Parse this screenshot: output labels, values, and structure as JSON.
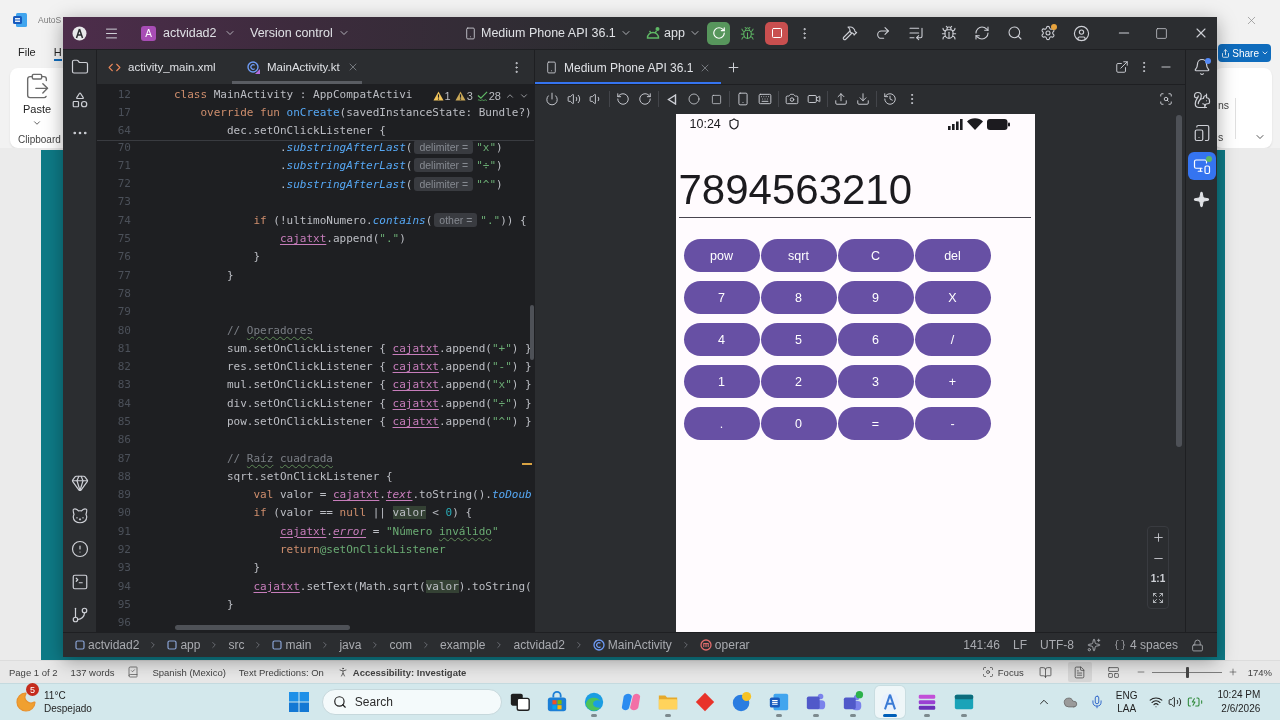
{
  "background_window": {
    "title": "AutoS",
    "menu": [
      {
        "label": "File",
        "selected": false
      },
      {
        "label": "H",
        "selected": true
      }
    ],
    "share": "Share",
    "paste": "Paste",
    "clipboard_group": "Clipboard",
    "ribbon_fragments": [
      "ns",
      "s"
    ]
  },
  "ide": {
    "title_bar": {
      "project_badge": "A",
      "project": "actvidad2",
      "version_control": "Version control",
      "device": "Medium Phone API 36.1",
      "run_config": "app"
    },
    "editor": {
      "tabs": [
        {
          "label": "activity_main.xml",
          "kind": "xml",
          "selected": false
        },
        {
          "label": "MainActivity.kt",
          "kind": "kotlin",
          "selected": true
        }
      ],
      "inspections": {
        "warnings": "1",
        "weak_warnings": "3",
        "typos": "28"
      },
      "sticky_lines": [
        {
          "number": "12",
          "code": [
            {
              "text": "class ",
              "kind": "kw"
            },
            {
              "text": "MainActivity : AppCompatActivi",
              "kind": "plain"
            }
          ]
        },
        {
          "number": "17",
          "code": [
            {
              "text": "    override fun ",
              "kind": "kw"
            },
            {
              "text": "onCreate",
              "kind": "fn"
            },
            {
              "text": "(savedInstanceState: Bundle?)",
              "kind": "plain"
            }
          ]
        },
        {
          "number": "64",
          "code": [
            {
              "text": "        dec.setOnClickListener {",
              "kind": "plain"
            }
          ]
        }
      ],
      "lines": [
        {
          "number": "70",
          "code": [
            {
              "text": "                .",
              "kind": "plain"
            },
            {
              "text": "substringAfterLast",
              "kind": "ext"
            },
            {
              "text": "(",
              "kind": "plain"
            },
            {
              "text": "delimiter =",
              "kind": "hint"
            },
            {
              "text": "\"x\"",
              "kind": "str"
            },
            {
              "text": ")",
              "kind": "plain"
            }
          ]
        },
        {
          "number": "71",
          "code": [
            {
              "text": "                .",
              "kind": "plain"
            },
            {
              "text": "substringAfterLast",
              "kind": "ext"
            },
            {
              "text": "(",
              "kind": "plain"
            },
            {
              "text": "delimiter =",
              "kind": "hint"
            },
            {
              "text": "\"÷\"",
              "kind": "str"
            },
            {
              "text": ")",
              "kind": "plain"
            }
          ]
        },
        {
          "number": "72",
          "code": [
            {
              "text": "                .",
              "kind": "plain"
            },
            {
              "text": "substringAfterLast",
              "kind": "ext"
            },
            {
              "text": "(",
              "kind": "plain"
            },
            {
              "text": "delimiter =",
              "kind": "hint"
            },
            {
              "text": "\"^\"",
              "kind": "str"
            },
            {
              "text": ")",
              "kind": "plain"
            }
          ]
        },
        {
          "number": "73"
        },
        {
          "number": "74",
          "code": [
            {
              "text": "            if ",
              "kind": "kw"
            },
            {
              "text": "(!ultimoNumero.",
              "kind": "plain"
            },
            {
              "text": "contains",
              "kind": "ext"
            },
            {
              "text": "(",
              "kind": "plain"
            },
            {
              "text": "other =",
              "kind": "hint"
            },
            {
              "text": "\".\"",
              "kind": "str"
            },
            {
              "text": ")) {",
              "kind": "plain"
            }
          ]
        },
        {
          "number": "75",
          "code": [
            {
              "text": "                cajatxt",
              "kind": "var"
            },
            {
              "text": ".append(",
              "kind": "plain"
            },
            {
              "text": "\".\"",
              "kind": "str"
            },
            {
              "text": ")",
              "kind": "plain"
            }
          ]
        },
        {
          "number": "76",
          "code": [
            {
              "text": "            }",
              "kind": "plain"
            }
          ]
        },
        {
          "number": "77",
          "code": [
            {
              "text": "        }",
              "kind": "plain"
            }
          ]
        },
        {
          "number": "78"
        },
        {
          "number": "79"
        },
        {
          "number": "80",
          "code": [
            {
              "text": "        // ",
              "kind": "cmt"
            },
            {
              "text": "Operadores",
              "kind": "cmt_typo"
            }
          ]
        },
        {
          "number": "81",
          "code": [
            {
              "text": "        sum.setOnClickListener { ",
              "kind": "plain"
            },
            {
              "text": "cajatxt",
              "kind": "var"
            },
            {
              "text": ".append(",
              "kind": "plain"
            },
            {
              "text": "\"+\"",
              "kind": "str"
            },
            {
              "text": ") }",
              "kind": "plain"
            }
          ]
        },
        {
          "number": "82",
          "code": [
            {
              "text": "        res.setOnClickListener { ",
              "kind": "plain"
            },
            {
              "text": "cajatxt",
              "kind": "var"
            },
            {
              "text": ".append(",
              "kind": "plain"
            },
            {
              "text": "\"-\"",
              "kind": "str"
            },
            {
              "text": ") }",
              "kind": "plain"
            }
          ]
        },
        {
          "number": "83",
          "code": [
            {
              "text": "        mul.setOnClickListener { ",
              "kind": "plain"
            },
            {
              "text": "cajatxt",
              "kind": "var"
            },
            {
              "text": ".append(",
              "kind": "plain"
            },
            {
              "text": "\"x\"",
              "kind": "str"
            },
            {
              "text": ") }",
              "kind": "plain"
            }
          ]
        },
        {
          "number": "84",
          "code": [
            {
              "text": "        div.setOnClickListener { ",
              "kind": "plain"
            },
            {
              "text": "cajatxt",
              "kind": "var"
            },
            {
              "text": ".append(",
              "kind": "plain"
            },
            {
              "text": "\"÷\"",
              "kind": "str"
            },
            {
              "text": ") }",
              "kind": "plain"
            }
          ]
        },
        {
          "number": "85",
          "code": [
            {
              "text": "        pow.setOnClickListener { ",
              "kind": "plain"
            },
            {
              "text": "cajatxt",
              "kind": "var"
            },
            {
              "text": ".append(",
              "kind": "plain"
            },
            {
              "text": "\"^\"",
              "kind": "str"
            },
            {
              "text": ") }",
              "kind": "plain"
            }
          ]
        },
        {
          "number": "86"
        },
        {
          "number": "87",
          "code": [
            {
              "text": "        // ",
              "kind": "cmt"
            },
            {
              "text": "Raíz",
              "kind": "cmt_typo"
            },
            {
              "text": " cuadrada",
              "kind": "cmt_typo"
            }
          ]
        },
        {
          "number": "88",
          "code": [
            {
              "text": "        sqrt.setOnClickListener {",
              "kind": "plain"
            }
          ]
        },
        {
          "number": "89",
          "code": [
            {
              "text": "            val ",
              "kind": "kw"
            },
            {
              "text": "valor = ",
              "kind": "plain"
            },
            {
              "text": "cajatxt",
              "kind": "var"
            },
            {
              "text": ".",
              "kind": "plain"
            },
            {
              "text": "text",
              "kind": "prop"
            },
            {
              "text": ".toString().",
              "kind": "plain"
            },
            {
              "text": "toDoub",
              "kind": "ext"
            }
          ]
        },
        {
          "number": "90",
          "code": [
            {
              "text": "            if ",
              "kind": "kw"
            },
            {
              "text": "(valor == ",
              "kind": "plain"
            },
            {
              "text": "null",
              "kind": "kw"
            },
            {
              "text": " || ",
              "kind": "plain"
            },
            {
              "text": "valor",
              "kind": "hl"
            },
            {
              "text": " < ",
              "kind": "plain"
            },
            {
              "text": "0",
              "kind": "num"
            },
            {
              "text": ") {",
              "kind": "plain"
            }
          ]
        },
        {
          "number": "91",
          "code": [
            {
              "text": "                cajatxt",
              "kind": "var"
            },
            {
              "text": ".",
              "kind": "plain"
            },
            {
              "text": "error",
              "kind": "prop"
            },
            {
              "text": " = ",
              "kind": "plain"
            },
            {
              "text": "\"Número ",
              "kind": "str"
            },
            {
              "text": "inválido",
              "kind": "str_typo"
            },
            {
              "text": "\"",
              "kind": "str"
            }
          ]
        },
        {
          "number": "92",
          "code": [
            {
              "text": "                return",
              "kind": "kw"
            },
            {
              "text": "@setOnClickListener",
              "kind": "label"
            }
          ]
        },
        {
          "number": "93",
          "code": [
            {
              "text": "            }",
              "kind": "plain"
            }
          ]
        },
        {
          "number": "94",
          "code": [
            {
              "text": "            cajatxt",
              "kind": "var"
            },
            {
              "text": ".setText(Math.sqrt(",
              "kind": "plain"
            },
            {
              "text": "valor",
              "kind": "hl"
            },
            {
              "text": ").toString(",
              "kind": "plain"
            }
          ]
        },
        {
          "number": "95",
          "code": [
            {
              "text": "        }",
              "kind": "plain"
            }
          ]
        },
        {
          "number": "96"
        }
      ]
    },
    "emulator": {
      "tabs": [
        {
          "label": "Medium Phone API 36.1",
          "selected": true
        }
      ],
      "phone": {
        "time": "10:24",
        "display": "7894563210",
        "keys": [
          [
            "pow",
            "sqrt",
            "C",
            "del"
          ],
          [
            "7",
            "8",
            "9",
            "X"
          ],
          [
            "4",
            "5",
            "6",
            "/"
          ],
          [
            "1",
            "2",
            "3",
            "+"
          ],
          [
            ".",
            "0",
            "=",
            "-"
          ]
        ]
      },
      "zoom_reset": "1:1"
    },
    "right_toolbar": [
      {
        "selected": false
      },
      {
        "selected": false
      },
      {
        "selected": false
      },
      {
        "selected": true
      },
      {
        "selected": false
      }
    ],
    "status_bar": {
      "breadcrumbs": [
        {
          "label": "actvidad2",
          "kind": "module"
        },
        {
          "label": "app",
          "kind": "module"
        },
        {
          "label": "src",
          "kind": "dir"
        },
        {
          "label": "main",
          "kind": "module"
        },
        {
          "label": "java",
          "kind": "dir"
        },
        {
          "label": "com",
          "kind": "dir"
        },
        {
          "label": "example",
          "kind": "dir"
        },
        {
          "label": "actvidad2",
          "kind": "dir"
        },
        {
          "label": "MainActivity",
          "kind": "class"
        },
        {
          "label": "operar",
          "kind": "method"
        }
      ],
      "position": "141:46",
      "line_separator": "LF",
      "encoding": "UTF-8",
      "indent": "4 spaces"
    }
  },
  "word_status_bar": {
    "page": "Page 1 of 2",
    "words": "137 words",
    "language": "Spanish (Mexico)",
    "predictions": "Text Predictions: On",
    "accessibility": "Accessibility: Investigate",
    "focus": "Focus",
    "views": [
      {
        "selected": false
      },
      {
        "selected": true
      },
      {
        "selected": false
      }
    ],
    "zoom_slider": {
      "level": 0.5
    },
    "zoom": "174%"
  },
  "taskbar": {
    "weather": {
      "badge": "5",
      "temperature": "11°C",
      "condition": "Despejado"
    },
    "search": {
      "placeholder": "Search"
    },
    "apps": [
      {
        "running": false,
        "selected": false
      },
      {
        "running": false,
        "selected": false
      },
      {
        "running": true,
        "selected": false
      },
      {
        "running": false,
        "selected": false
      },
      {
        "running": true,
        "selected": false
      },
      {
        "running": false,
        "selected": false
      },
      {
        "running": false,
        "selected": false
      },
      {
        "running": true,
        "selected": false
      },
      {
        "running": true,
        "selected": false
      },
      {
        "running": true,
        "selected": false
      },
      {
        "running": true,
        "selected": true
      },
      {
        "running": true,
        "selected": false
      },
      {
        "running": true,
        "selected": false
      }
    ],
    "language": [
      "ENG",
      "LAA"
    ],
    "time": "10:24 PM",
    "date": "2/6/2026"
  }
}
